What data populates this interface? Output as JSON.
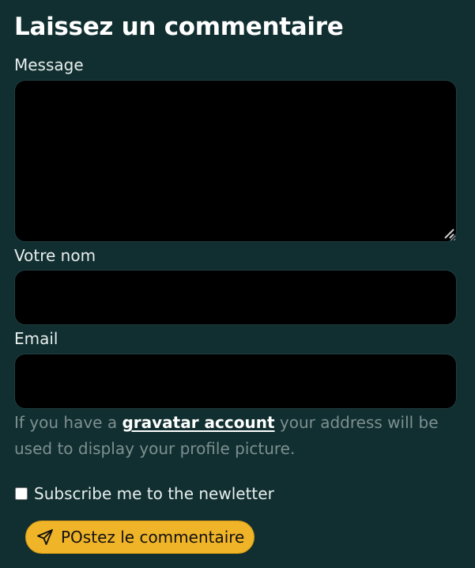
{
  "form": {
    "title": "Laissez un commentaire",
    "message_label": "Message",
    "message_value": "",
    "name_label": "Votre nom",
    "name_value": "",
    "email_label": "Email",
    "email_value": "",
    "hint_prefix": "If you have a ",
    "hint_link": "gravatar account",
    "hint_suffix": " your address will be used to display your profile picture.",
    "subscribe_label": "Subscribe me to the newletter",
    "subscribe_checked": false,
    "submit_label": "POstez le commentaire",
    "submit_icon": "send-icon"
  },
  "colors": {
    "background": "#112f30",
    "field": "#000000",
    "button": "#f0b428",
    "hint_text": "#7e8f90"
  }
}
